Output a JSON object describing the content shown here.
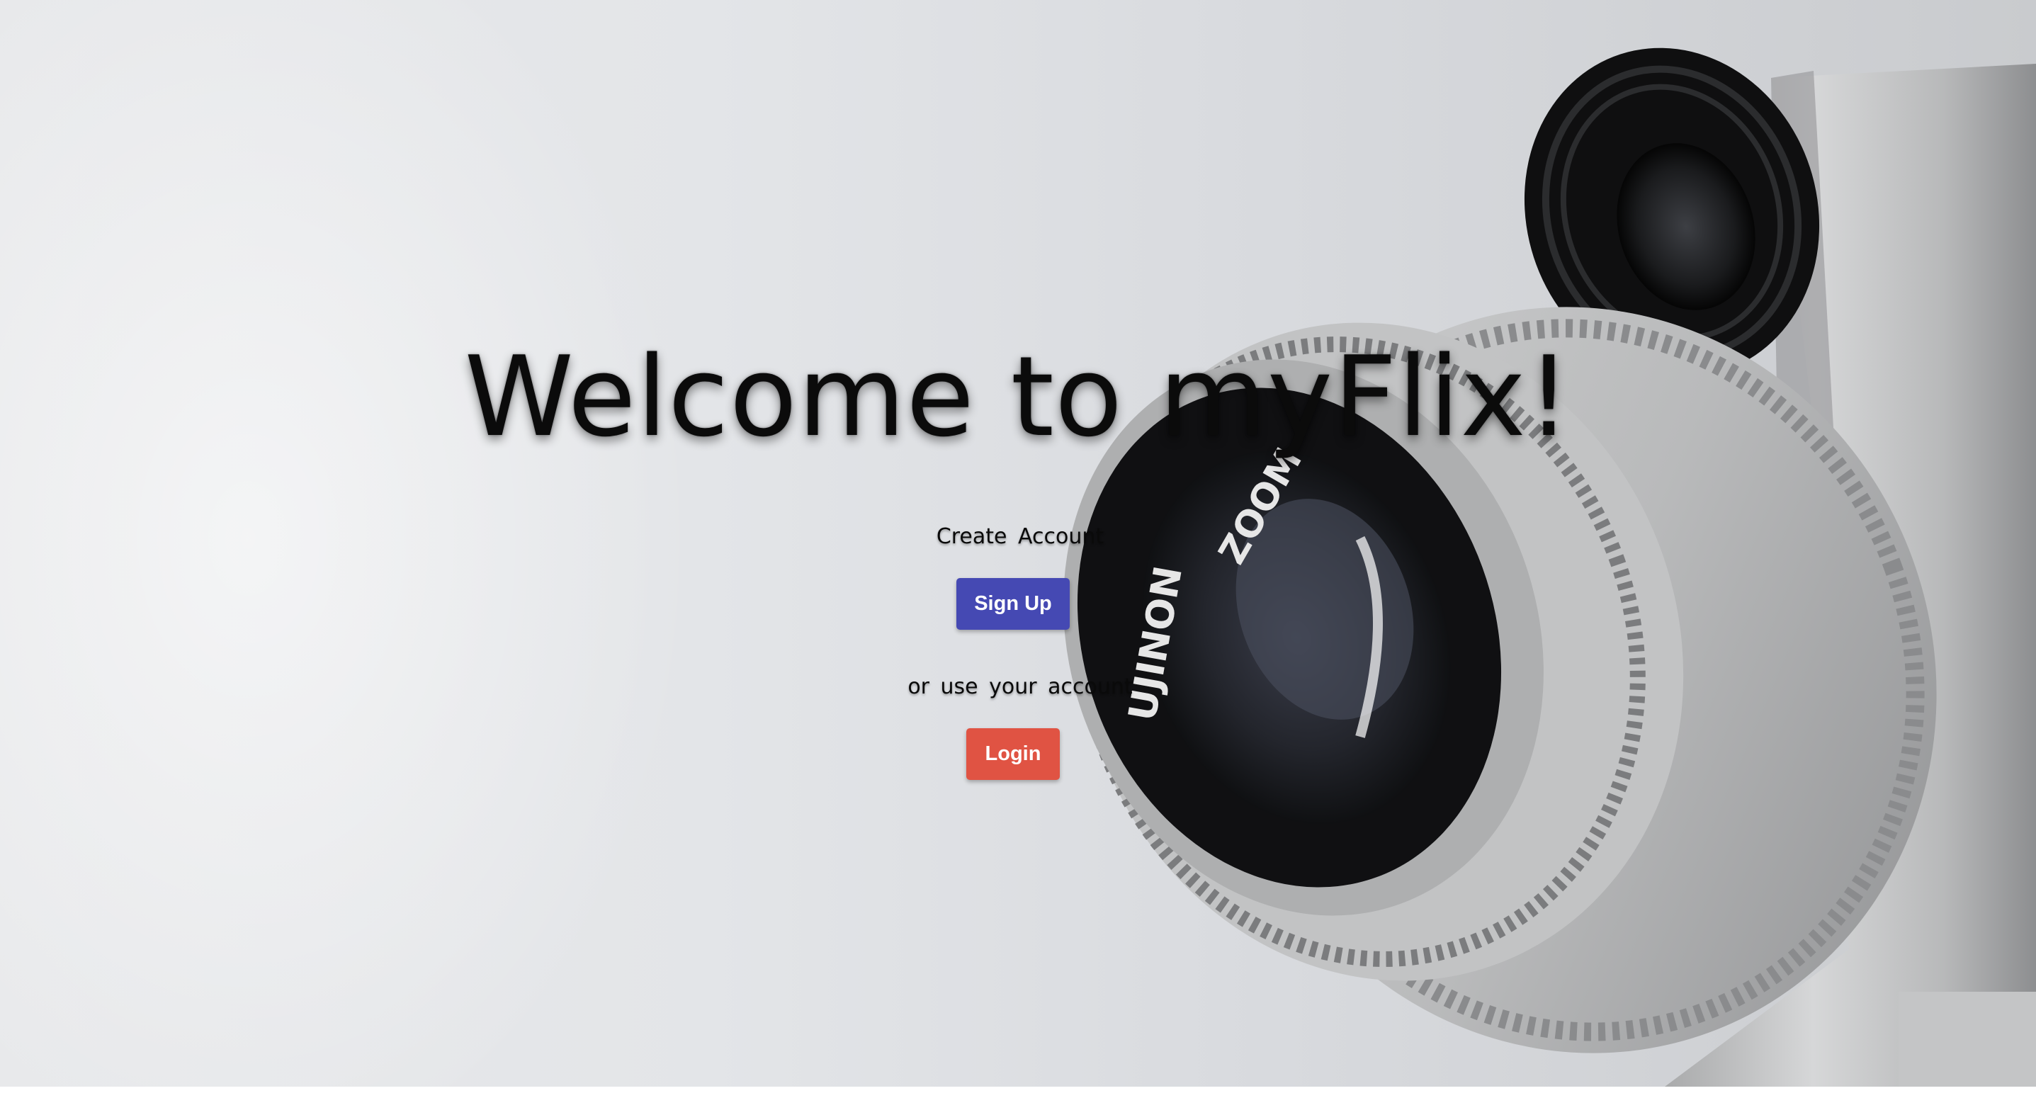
{
  "hero": {
    "title": "Welcome to myFlix!",
    "background_image": "camera-lens-photo"
  },
  "signup_section": {
    "prompt": "Create Account",
    "button_label": "Sign Up",
    "button_color": "#4549b3"
  },
  "login_section": {
    "prompt": "or use your account",
    "button_label": "Login",
    "button_color": "#e05343"
  }
}
